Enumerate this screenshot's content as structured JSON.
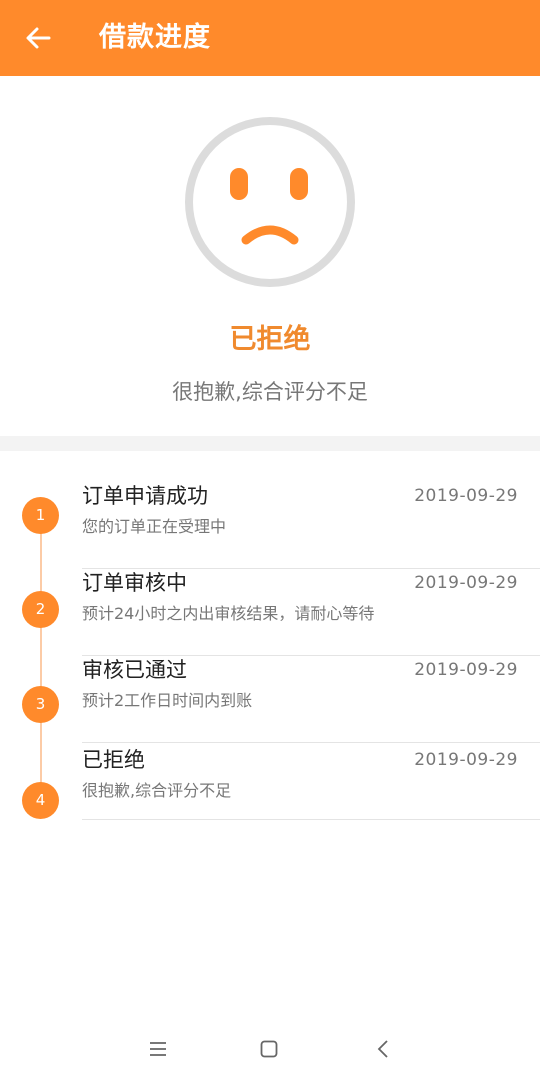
{
  "header": {
    "title": "借款进度",
    "back_icon": "arrow-left-icon"
  },
  "status": {
    "icon": "sad-face-icon",
    "title": "已拒绝",
    "subtitle": "很抱歉,综合评分不足",
    "accent_color": "#FF8A2B"
  },
  "timeline": {
    "steps": [
      {
        "number": "1",
        "title": "订单申请成功",
        "date": "2019-09-29",
        "desc": "您的订单正在受理中"
      },
      {
        "number": "2",
        "title": "订单审核中",
        "date": "2019-09-29",
        "desc": "预计24小时之内出审核结果，请耐心等待"
      },
      {
        "number": "3",
        "title": "审核已通过",
        "date": "2019-09-29",
        "desc": "预计2工作日时间内到账"
      },
      {
        "number": "4",
        "title": "已拒绝",
        "date": "2019-09-29",
        "desc": "很抱歉,综合评分不足"
      }
    ]
  },
  "navbar": {
    "items": [
      "menu-icon",
      "home-square-icon",
      "back-chevron-icon"
    ]
  }
}
